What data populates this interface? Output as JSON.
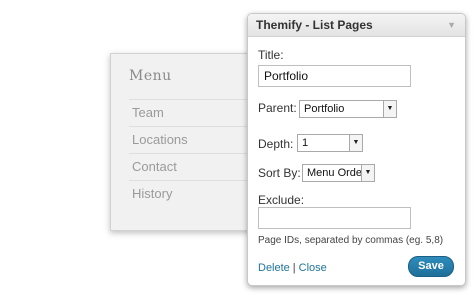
{
  "menu_widget": {
    "title": "Menu",
    "items": [
      {
        "label": "Team"
      },
      {
        "label": "Locations"
      },
      {
        "label": "Contact"
      },
      {
        "label": "History"
      }
    ]
  },
  "dialog": {
    "title": "Themify - List Pages",
    "toggle_icon": "triangle-down-icon",
    "title_label": "Title:",
    "title_value": "Portfolio",
    "parent_label": "Parent:",
    "parent_value": "Portfolio",
    "depth_label": "Depth:",
    "depth_value": "1",
    "sort_label": "Sort By:",
    "sort_value": "Menu Order",
    "exclude_label": "Exclude:",
    "exclude_value": "",
    "exclude_hint": "Page IDs, separated by commas (eg. 5,8)",
    "delete_label": "Delete",
    "close_label": "Close",
    "link_separator": "|",
    "save_label": "Save"
  },
  "colors": {
    "link": "#21759b",
    "save_button": "#2581b1"
  }
}
